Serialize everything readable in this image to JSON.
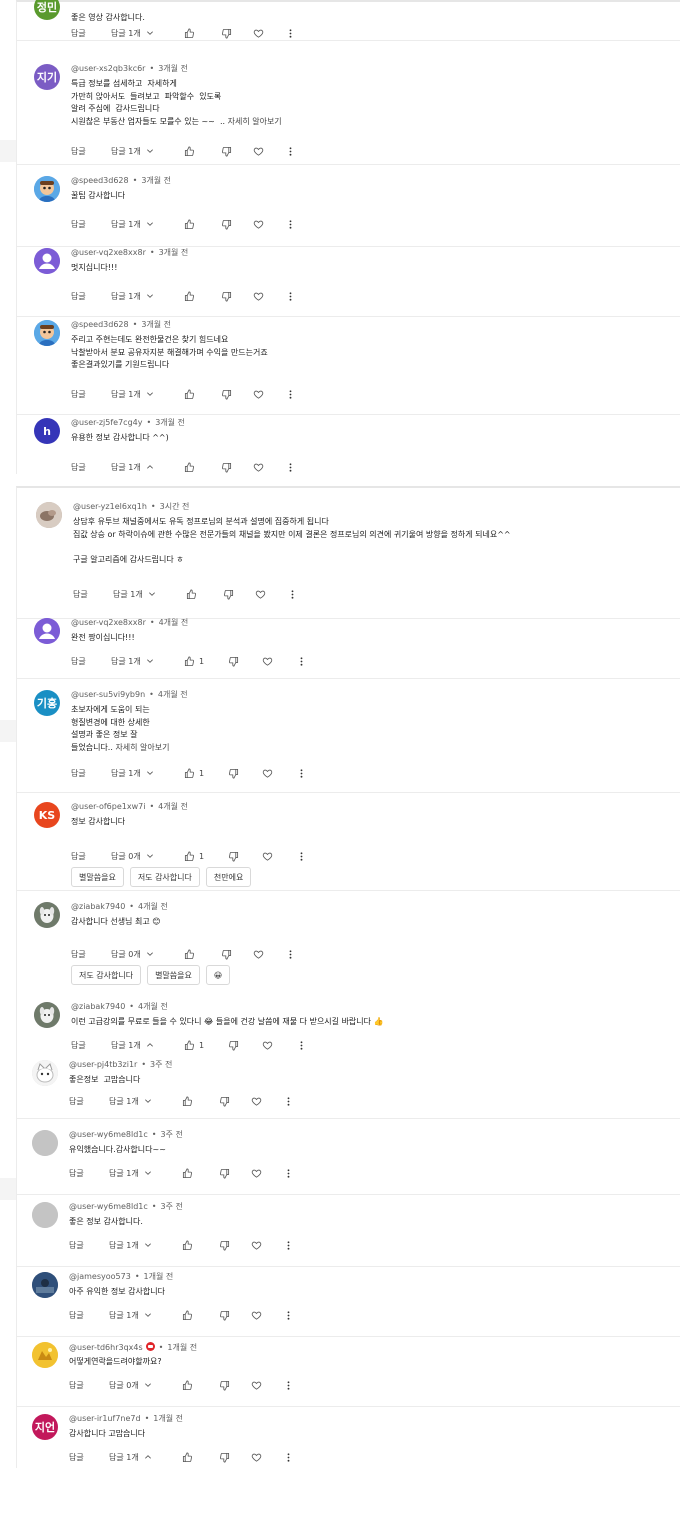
{
  "labels": {
    "reply": "답글",
    "replies_1": "답글 1개",
    "replies_0": "답글 0개",
    "read_more": "자세히 알아보기"
  },
  "comments": [
    {
      "avatar_text": "정민",
      "avatar_color": "#5a9a2e",
      "author": "",
      "time": "",
      "body": [
        "좋은 영상 감사합니다."
      ],
      "replies_label": "답글 1개",
      "likes": "",
      "expanded": false
    },
    {
      "avatar_text": "지기",
      "avatar_color": "#7b5cc4",
      "author": "@user-xs2qb3kc6r",
      "time": "3개월 전",
      "body": [
        "특급 정보를 섬세하고  자세하게",
        "가만히 앉아서도  들려보고  파악할수  있도록",
        "알려 주심에  감사드립니다",
        "시원찮은 부동산 업자들도 모를수 있는 ~~  .."
      ],
      "read_more": true,
      "replies_label": "답글 1개",
      "likes": "",
      "expanded": false
    },
    {
      "avatar_text": "",
      "avatar_kind": "cartoon",
      "avatar_color": "#4a90d9",
      "author": "@speed3d628",
      "time": "3개월 전",
      "body": [
        "꿀팁 감사합니다"
      ],
      "replies_label": "답글 1개",
      "likes": "",
      "expanded": false
    },
    {
      "avatar_text": "",
      "avatar_kind": "person",
      "avatar_color": "#7c5cd6",
      "author": "@user-vq2xe8xx8r",
      "time": "3개월 전",
      "body": [
        "멋지십니다!!!"
      ],
      "replies_label": "답글 1개",
      "likes": "",
      "expanded": false
    },
    {
      "avatar_text": "",
      "avatar_kind": "cartoon",
      "avatar_color": "#4a90d9",
      "author": "@speed3d628",
      "time": "3개월 전",
      "body": [
        "주리고 주현는데도 완전한물건은 찾기 힘드네요",
        "낙찰받아서 분묘 공유자지분 해결해가며 수익을 만드는거죠",
        "좋은결과있기를 기원드립니다"
      ],
      "replies_label": "답글 1개",
      "likes": "",
      "expanded": false
    },
    {
      "avatar_text": "h",
      "avatar_color": "#3535b8",
      "author": "@user-zj5fe7cg4y",
      "time": "3개월 전",
      "body": [
        "유용한 정보 감사합니다 ^^)"
      ],
      "replies_label": "답글 1개",
      "likes": "",
      "expanded": true
    },
    {
      "avatar_text": "",
      "avatar_kind": "photo",
      "avatar_color": "#b9a89a",
      "author": "@user-yz1el6xq1h",
      "time": "3시간 전",
      "body": [
        "상담후 유투브 채널중에서도 유독 정프로님의 분석과 설명에 집중하게 됩니다",
        "집값 상승 or 하락이슈에 관한 수많은 전문가들의 채널을 봤지만 이제 결론은 정프로님의 의견에 귀기울여 방향을 정하게 되네요^^",
        "",
        "구글 알고리즘에 감사드립니다 ㅎ"
      ],
      "replies_label": "답글 1개",
      "likes": "",
      "expanded": false
    },
    {
      "avatar_text": "",
      "avatar_kind": "person",
      "avatar_color": "#7c5cd6",
      "author": "@user-vq2xe8xx8r",
      "time": "4개월 전",
      "body": [
        "완전 짱이십니다!!!"
      ],
      "replies_label": "답글 1개",
      "likes": "1",
      "expanded": false
    },
    {
      "avatar_text": "기홍",
      "avatar_color": "#1a8fc4",
      "author": "@user-su5vi9yb9n",
      "time": "4개월 전",
      "body": [
        "초보자에게 도움이 되는",
        "형질변경에 대한 상세한",
        "설명과 좋은 정보 잘",
        "들었습니다.."
      ],
      "read_more": true,
      "replies_label": "답글 1개",
      "likes": "1",
      "expanded": false
    },
    {
      "avatar_text": "KS",
      "avatar_color": "#e8461e",
      "author": "@user-of6pe1xw7i",
      "time": "4개월 전",
      "body": [
        "정보 감사합니다"
      ],
      "replies_label": "답글 0개",
      "likes": "1",
      "expanded": false,
      "chips": [
        "별말씀을요",
        "저도 감사합니다",
        "천만에요"
      ]
    },
    {
      "avatar_text": "",
      "avatar_kind": "dog",
      "avatar_color": "#8a8a8a",
      "author": "@ziabak7940",
      "time": "4개월 전",
      "body": [
        "감사합니다 선생님 최고 😊"
      ],
      "replies_label": "답글 0개",
      "likes": "",
      "expanded": false,
      "chips": [
        "저도 감사합니다",
        "별말씀을요",
        "😀"
      ]
    },
    {
      "avatar_text": "",
      "avatar_kind": "dog",
      "avatar_color": "#8a8a8a",
      "author": "@ziabak7940",
      "time": "4개월 전",
      "body": [
        "이런 고급강의를 무료로 들을 수 있다니 😂 들을에 건강 날씀에 재물 다 받으시길 바랍니다 👍"
      ],
      "replies_label": "답글 1개",
      "likes": "1",
      "expanded": true
    },
    {
      "avatar_text": "",
      "avatar_kind": "cat",
      "avatar_color": "#ddd",
      "author": "@user-pj4tb3zi1r",
      "time": "3주 전",
      "body": [
        "좋은정보  고맙습니다"
      ],
      "replies_label": "답글 1개",
      "likes": "",
      "expanded": false
    },
    {
      "avatar_text": "",
      "avatar_kind": "grey",
      "avatar_color": "#c4c4c4",
      "author": "@user-wy6me8ld1c",
      "time": "3주 전",
      "body": [
        "유익했습니다.감사합니다~~"
      ],
      "replies_label": "답글 1개",
      "likes": "",
      "expanded": false
    },
    {
      "avatar_text": "",
      "avatar_kind": "grey",
      "avatar_color": "#c4c4c4",
      "author": "@user-wy6me8ld1c",
      "time": "3주 전",
      "body": [
        "좋은 정보 감사합니다."
      ],
      "replies_label": "답글 1개",
      "likes": "",
      "expanded": false
    },
    {
      "avatar_text": "",
      "avatar_kind": "photo2",
      "avatar_color": "#2f4f7a",
      "author": "@jamesyoo573",
      "time": "1개월 전",
      "body": [
        "아주 유익한 정보 감사합니다"
      ],
      "replies_label": "답글 1개",
      "likes": "",
      "expanded": false
    },
    {
      "avatar_text": "",
      "avatar_kind": "yellow",
      "avatar_color": "#f2c230",
      "author": "@user-td6hr3qx4s",
      "time": "1개월 전",
      "badge": true,
      "body": [
        "어떻게연락을드려야할까요?"
      ],
      "replies_label": "답글 0개",
      "likes": "",
      "expanded": false
    },
    {
      "avatar_text": "지언",
      "avatar_color": "#c2185b",
      "author": "@user-ir1uf7ne7d",
      "time": "1개월 전",
      "body": [
        "감사합니다 고맙습니다"
      ],
      "replies_label": "답글 1개",
      "likes": "",
      "expanded": true
    }
  ]
}
